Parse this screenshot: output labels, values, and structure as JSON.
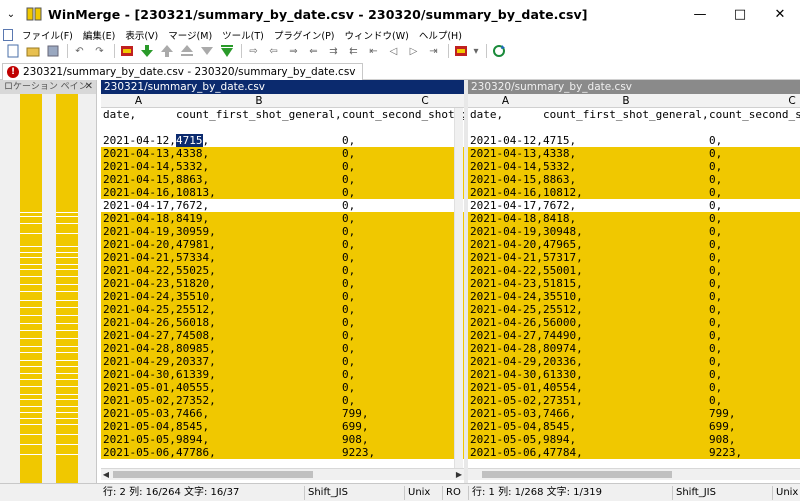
{
  "window": {
    "title": "WinMerge - [230321/summary_by_date.csv - 230320/summary_by_date.csv]",
    "minimize_label": "—",
    "maximize_label": "□",
    "close_label": "✕",
    "sysmenu_label": "⌄"
  },
  "menu": [
    "ファイル(F)",
    "編集(E)",
    "表示(V)",
    "マージ(M)",
    "ツール(T)",
    "プラグイン(P)",
    "ウィンドウ(W)",
    "ヘルプ(H)"
  ],
  "tab": {
    "label": "230321/summary_by_date.csv - 230320/summary_by_date.csv",
    "badge": "!"
  },
  "location_pane": {
    "title": "ロケーション ペイン",
    "close": "✕"
  },
  "left": {
    "path": "230321/summary_by_date.csv",
    "col_headers": [
      "A",
      "B",
      "C"
    ],
    "header_row": [
      "date,",
      "count_first_shot_general,",
      "count_second_shot_g"
    ],
    "rows": [
      {
        "a": "2021-04-12,",
        "b": "4715,",
        "c": "0,",
        "diff": false,
        "sel": true
      },
      {
        "a": "2021-04-13,",
        "b": "4338,",
        "c": "0,",
        "diff": true
      },
      {
        "a": "2021-04-14,",
        "b": "5332,",
        "c": "0,",
        "diff": true
      },
      {
        "a": "2021-04-15,",
        "b": "8863,",
        "c": "0,",
        "diff": true
      },
      {
        "a": "2021-04-16,",
        "b": "10813,",
        "c": "0,",
        "diff": true
      },
      {
        "a": "2021-04-17,",
        "b": "7672,",
        "c": "0,",
        "diff": false
      },
      {
        "a": "2021-04-18,",
        "b": "8419,",
        "c": "0,",
        "diff": true
      },
      {
        "a": "2021-04-19,",
        "b": "30959,",
        "c": "0,",
        "diff": true
      },
      {
        "a": "2021-04-20,",
        "b": "47981,",
        "c": "0,",
        "diff": true
      },
      {
        "a": "2021-04-21,",
        "b": "57334,",
        "c": "0,",
        "diff": true
      },
      {
        "a": "2021-04-22,",
        "b": "55025,",
        "c": "0,",
        "diff": true
      },
      {
        "a": "2021-04-23,",
        "b": "51820,",
        "c": "0,",
        "diff": true
      },
      {
        "a": "2021-04-24,",
        "b": "35510,",
        "c": "0,",
        "diff": true
      },
      {
        "a": "2021-04-25,",
        "b": "25512,",
        "c": "0,",
        "diff": true
      },
      {
        "a": "2021-04-26,",
        "b": "56018,",
        "c": "0,",
        "diff": true
      },
      {
        "a": "2021-04-27,",
        "b": "74508,",
        "c": "0,",
        "diff": true
      },
      {
        "a": "2021-04-28,",
        "b": "80985,",
        "c": "0,",
        "diff": true
      },
      {
        "a": "2021-04-29,",
        "b": "20337,",
        "c": "0,",
        "diff": true
      },
      {
        "a": "2021-04-30,",
        "b": "61339,",
        "c": "0,",
        "diff": true
      },
      {
        "a": "2021-05-01,",
        "b": "40555,",
        "c": "0,",
        "diff": true
      },
      {
        "a": "2021-05-02,",
        "b": "27352,",
        "c": "0,",
        "diff": true
      },
      {
        "a": "2021-05-03,",
        "b": "7466,",
        "c": "799,",
        "diff": true
      },
      {
        "a": "2021-05-04,",
        "b": "8545,",
        "c": "699,",
        "diff": true
      },
      {
        "a": "2021-05-05,",
        "b": "9894,",
        "c": "908,",
        "diff": true
      },
      {
        "a": "2021-05-06,",
        "b": "47786,",
        "c": "9223,",
        "diff": true
      }
    ]
  },
  "right": {
    "path": "230320/summary_by_date.csv",
    "col_headers": [
      "A",
      "B",
      "C"
    ],
    "header_row": [
      "date,",
      "count_first_shot_general,",
      "count_second_s"
    ],
    "rows": [
      {
        "a": "2021-04-12,",
        "b": "4715,",
        "c": "0,",
        "diff": false
      },
      {
        "a": "2021-04-13,",
        "b": "4338,",
        "c": "0,",
        "diff": true
      },
      {
        "a": "2021-04-14,",
        "b": "5332,",
        "c": "0,",
        "diff": true
      },
      {
        "a": "2021-04-15,",
        "b": "8863,",
        "c": "0,",
        "diff": true
      },
      {
        "a": "2021-04-16,",
        "b": "10812,",
        "c": "0,",
        "diff": true
      },
      {
        "a": "2021-04-17,",
        "b": "7672,",
        "c": "0,",
        "diff": false
      },
      {
        "a": "2021-04-18,",
        "b": "8418,",
        "c": "0,",
        "diff": true
      },
      {
        "a": "2021-04-19,",
        "b": "30948,",
        "c": "0,",
        "diff": true
      },
      {
        "a": "2021-04-20,",
        "b": "47965,",
        "c": "0,",
        "diff": true
      },
      {
        "a": "2021-04-21,",
        "b": "57317,",
        "c": "0,",
        "diff": true
      },
      {
        "a": "2021-04-22,",
        "b": "55001,",
        "c": "0,",
        "diff": true
      },
      {
        "a": "2021-04-23,",
        "b": "51815,",
        "c": "0,",
        "diff": true
      },
      {
        "a": "2021-04-24,",
        "b": "35510,",
        "c": "0,",
        "diff": true
      },
      {
        "a": "2021-04-25,",
        "b": "25512,",
        "c": "0,",
        "diff": true
      },
      {
        "a": "2021-04-26,",
        "b": "56000,",
        "c": "0,",
        "diff": true
      },
      {
        "a": "2021-04-27,",
        "b": "74490,",
        "c": "0,",
        "diff": true
      },
      {
        "a": "2021-04-28,",
        "b": "80974,",
        "c": "0,",
        "diff": true
      },
      {
        "a": "2021-04-29,",
        "b": "20336,",
        "c": "0,",
        "diff": true
      },
      {
        "a": "2021-04-30,",
        "b": "61330,",
        "c": "0,",
        "diff": true
      },
      {
        "a": "2021-05-01,",
        "b": "40554,",
        "c": "0,",
        "diff": true
      },
      {
        "a": "2021-05-02,",
        "b": "27351,",
        "c": "0,",
        "diff": true
      },
      {
        "a": "2021-05-03,",
        "b": "7466,",
        "c": "799,",
        "diff": true
      },
      {
        "a": "2021-05-04,",
        "b": "8545,",
        "c": "699,",
        "diff": true
      },
      {
        "a": "2021-05-05,",
        "b": "9894,",
        "c": "908,",
        "diff": true
      },
      {
        "a": "2021-05-06,",
        "b": "47784,",
        "c": "9223,",
        "diff": true
      }
    ]
  },
  "status": {
    "left_pos": "行: 2  列: 16/264  文字: 16/37",
    "left_enc": "Shift_JIS",
    "left_eol": "Unix",
    "left_ro": "RO",
    "right_pos": "行: 1  列: 1/268  文字: 1/319",
    "right_enc": "Shift_JIS",
    "right_eol": "Unix"
  },
  "colors": {
    "diff": "#f0c800",
    "active_header": "#0b2a6e",
    "inactive_header": "#8a8a8a",
    "error_badge": "#c00000"
  }
}
